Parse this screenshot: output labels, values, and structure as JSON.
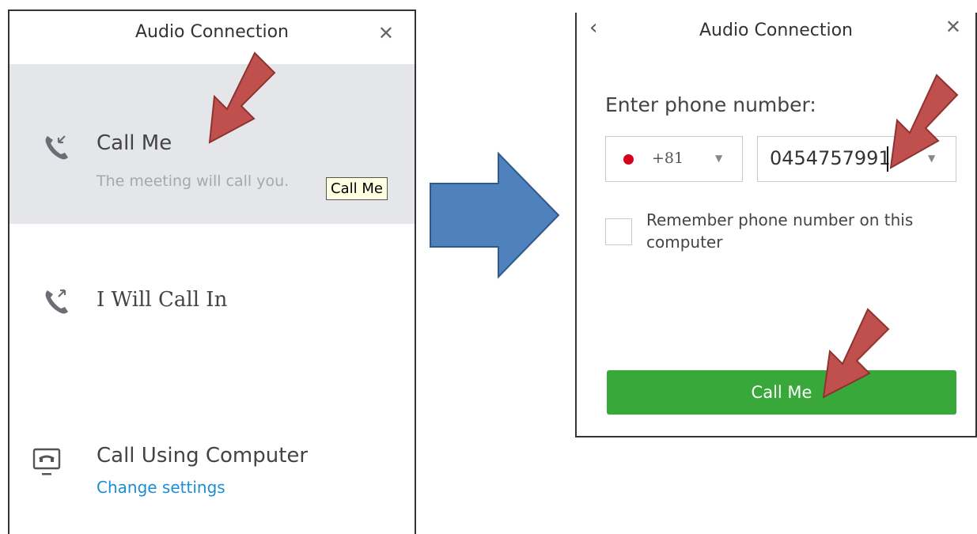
{
  "colors": {
    "highlight_bg": "#e4e6e9",
    "link": "#1a8fd6",
    "primary_button": "#37a839",
    "tooltip_bg": "#ffffe1",
    "annotation_arrow": "#c0504d",
    "flow_arrow": "#4f81bd"
  },
  "left_dialog": {
    "title": "Audio Connection",
    "close_icon": "close-icon",
    "options": {
      "call_me": {
        "label": "Call Me",
        "subtitle": "The meeting will call you.",
        "icon": "phone-incoming-icon"
      },
      "call_in": {
        "label": "I Will Call In",
        "icon": "phone-outgoing-icon"
      },
      "computer": {
        "label": "Call Using Computer",
        "link": "Change settings",
        "icon": "computer-audio-icon"
      }
    },
    "tooltip": "Call Me"
  },
  "right_dialog": {
    "title": "Audio Connection",
    "back_icon": "chevron-left-icon",
    "close_icon": "close-icon",
    "phone_label": "Enter phone number:",
    "country": {
      "flag": "japan-flag-icon",
      "code": "+81"
    },
    "phone_value": "0454757991",
    "remember_label": "Remember phone number on this computer",
    "remember_checked": false,
    "button_label": "Call Me"
  }
}
